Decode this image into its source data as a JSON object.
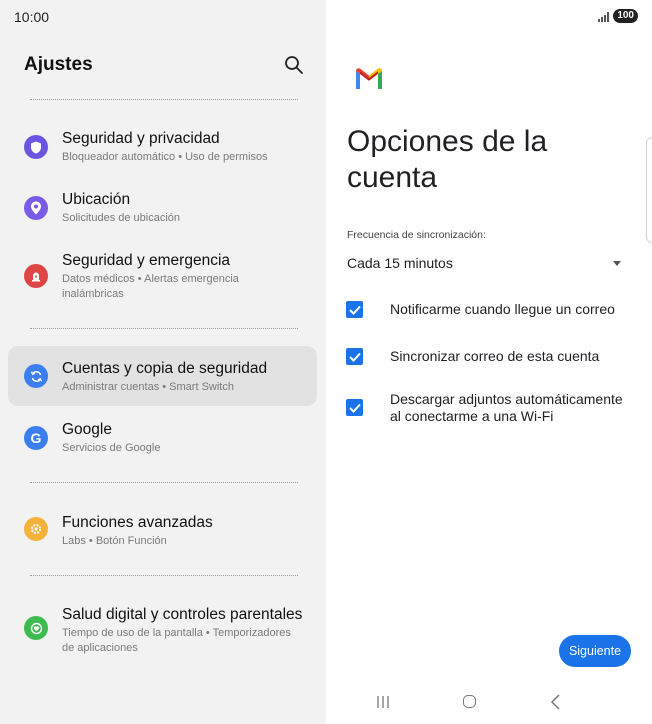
{
  "status_bar": {
    "time": "10:00",
    "battery": "100"
  },
  "settings": {
    "title": "Ajustes",
    "items": [
      {
        "title": "Seguridad y privacidad",
        "subtitle": "Bloqueador automático  •  Uso de permisos",
        "icon": "shield-icon",
        "color": "#6b55e0"
      },
      {
        "title": "Ubicación",
        "subtitle": "Solicitudes de ubicación",
        "icon": "location-pin-icon",
        "color": "#7a5be8"
      },
      {
        "title": "Seguridad y emergencia",
        "subtitle": "Datos médicos  •  Alertas emergencia inalámbricas",
        "icon": "emergency-icon",
        "color": "#e04545"
      },
      {
        "title": "Cuentas y copia de seguridad",
        "subtitle": "Administrar cuentas  •  Smart Switch",
        "icon": "sync-icon",
        "color": "#3b7ef0"
      },
      {
        "title": "Google",
        "subtitle": "Servicios de Google",
        "icon": "google-icon",
        "color": "#3b7ef0"
      },
      {
        "title": "Funciones avanzadas",
        "subtitle": "Labs  •  Botón Función",
        "icon": "gear-plus-icon",
        "color": "#f5b23a"
      },
      {
        "title": "Salud digital y controles parentales",
        "subtitle": "Tiempo de uso de la pantalla  •  Temporizadores de aplicaciones",
        "icon": "heart-circle-icon",
        "color": "#3dbb4e"
      }
    ]
  },
  "account_options": {
    "heading": "Opciones de la cuenta",
    "sync_label": "Frecuencia de sincronización:",
    "sync_value": "Cada 15 minutos",
    "checkboxes": [
      {
        "label": "Notificarme cuando llegue un correo",
        "checked": true
      },
      {
        "label": "Sincronizar correo de esta cuenta",
        "checked": true
      },
      {
        "label": "Descargar adjuntos automáticamente al conectarme a una Wi-Fi",
        "checked": true
      }
    ],
    "next_button": "Siguiente"
  }
}
